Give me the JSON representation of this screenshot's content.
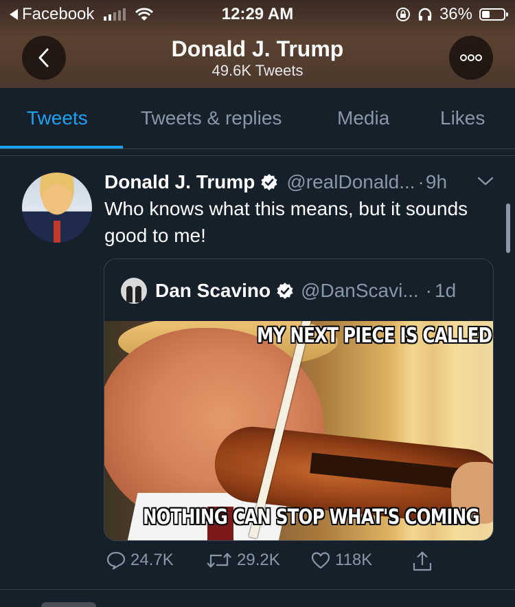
{
  "status_bar": {
    "back_app": "Facebook",
    "time": "12:29 AM",
    "battery": "36%",
    "battery_level": 0.36
  },
  "header": {
    "title": "Donald J. Trump",
    "subtitle": "49.6K Tweets",
    "back_icon": "chevron-left-icon",
    "more_icon": "more-icon"
  },
  "tabs": [
    {
      "label": "Tweets",
      "active": true
    },
    {
      "label": "Tweets & replies",
      "active": false
    },
    {
      "label": "Media",
      "active": false
    },
    {
      "label": "Likes",
      "active": false
    }
  ],
  "tweet": {
    "author_name": "Donald J. Trump",
    "handle": "@realDonald...",
    "separator": "·",
    "time": "9h",
    "text": "Who knows what this means, but it sounds good to me!",
    "quote": {
      "author_name": "Dan Scavino",
      "handle": "@DanScavi...",
      "separator": "·",
      "time": "1d",
      "image_text_top": "MY NEXT PIECE IS CALLED",
      "image_text_bottom": "NOTHING CAN STOP WHAT'S COMING"
    },
    "actions": {
      "replies": "24.7K",
      "retweets": "29.2K",
      "likes": "118K"
    }
  },
  "colors": {
    "background": "#15202b",
    "accent": "#1da1f2",
    "muted": "#8899a6",
    "border": "#38444d"
  }
}
